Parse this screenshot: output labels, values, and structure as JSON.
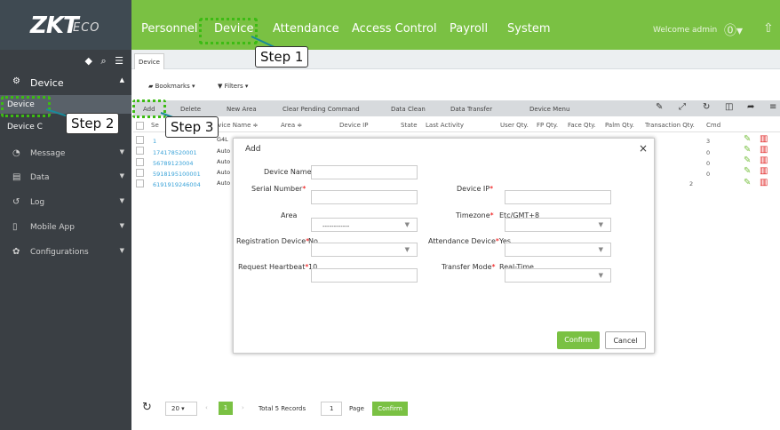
{
  "header": {
    "logo_main": "ZKT",
    "logo_sub": "ECO",
    "nav": [
      "Personnel",
      "Device",
      "Attendance",
      "Access Control",
      "Payroll",
      "System"
    ],
    "welcome": "Welcome admin"
  },
  "sidebar": {
    "items": [
      {
        "label": "Device",
        "icon": "device-icon"
      },
      {
        "label": "Message",
        "icon": "message-icon"
      },
      {
        "label": "Data",
        "icon": "database-icon"
      },
      {
        "label": "Log",
        "icon": "history-icon"
      },
      {
        "label": "Mobile App",
        "icon": "mobile-icon"
      },
      {
        "label": "Configurations",
        "icon": "gear-icon"
      }
    ],
    "sub_device": "Device",
    "sub_device_cmd": "Device C"
  },
  "tab": "Device",
  "filterbar": {
    "bookmarks": "Bookmarks ▾",
    "filters": "Filters ▾"
  },
  "actions": [
    "Add",
    "Delete",
    "New Area",
    "Clear Pending Command",
    "Data Clean",
    "Data Transfer",
    "Device Menu"
  ],
  "columns": [
    "Se",
    "evice Name ≑",
    "Area ≑",
    "Device IP",
    "State",
    "Last Activity",
    "User Qty.",
    "FP Qty.",
    "Face Qty.",
    "Palm Qty.",
    "Transaction Qty.",
    "Cmd"
  ],
  "rows": [
    {
      "sn": "1",
      "area": "G4L",
      "cmd": "3",
      "tq": ""
    },
    {
      "sn": "174178520001",
      "area": "Auto",
      "cmd": "0",
      "tq": ""
    },
    {
      "sn": "56789123004",
      "area": "Auto",
      "cmd": "0",
      "tq": ""
    },
    {
      "sn": "5918195100001",
      "area": "Auto",
      "cmd": "0",
      "tq": "2"
    },
    {
      "sn": "6191919246004",
      "area": "Auto",
      "cmd": "",
      "tq": ""
    }
  ],
  "dialog": {
    "title": "Add",
    "close": "×",
    "device_name_label": "Device Name",
    "serial_number_label": "Serial Number",
    "device_ip_label": "Device IP",
    "area_label": "Area",
    "area_value": "------------",
    "timezone_label": "Timezone",
    "timezone_value": "Etc/GMT+8",
    "registration_label": "Registration Device",
    "registration_value": "No",
    "attendance_label": "Attendance Device",
    "attendance_value": "Yes",
    "heartbeat_label": "Request Heartbeat",
    "heartbeat_value": "10",
    "transfer_label": "Transfer Mode",
    "transfer_value": "Real-Time",
    "required_mark": "*",
    "confirm": "Confirm",
    "cancel": "Cancel"
  },
  "pager": {
    "page_size": "20",
    "page": "1",
    "total": "Total 5 Records",
    "page_input": "1",
    "page_label": "Page",
    "confirm": "Confirm"
  },
  "callouts": {
    "step1": "Step 1",
    "step2": "Step 2",
    "step3": "Step 3"
  },
  "colors": {
    "brand_green": "#7ac143",
    "sidebar": "#3a3f44",
    "link_blue": "#39a2d8",
    "delete_red": "#e02424",
    "callout_dotted": "#3cbb13"
  }
}
